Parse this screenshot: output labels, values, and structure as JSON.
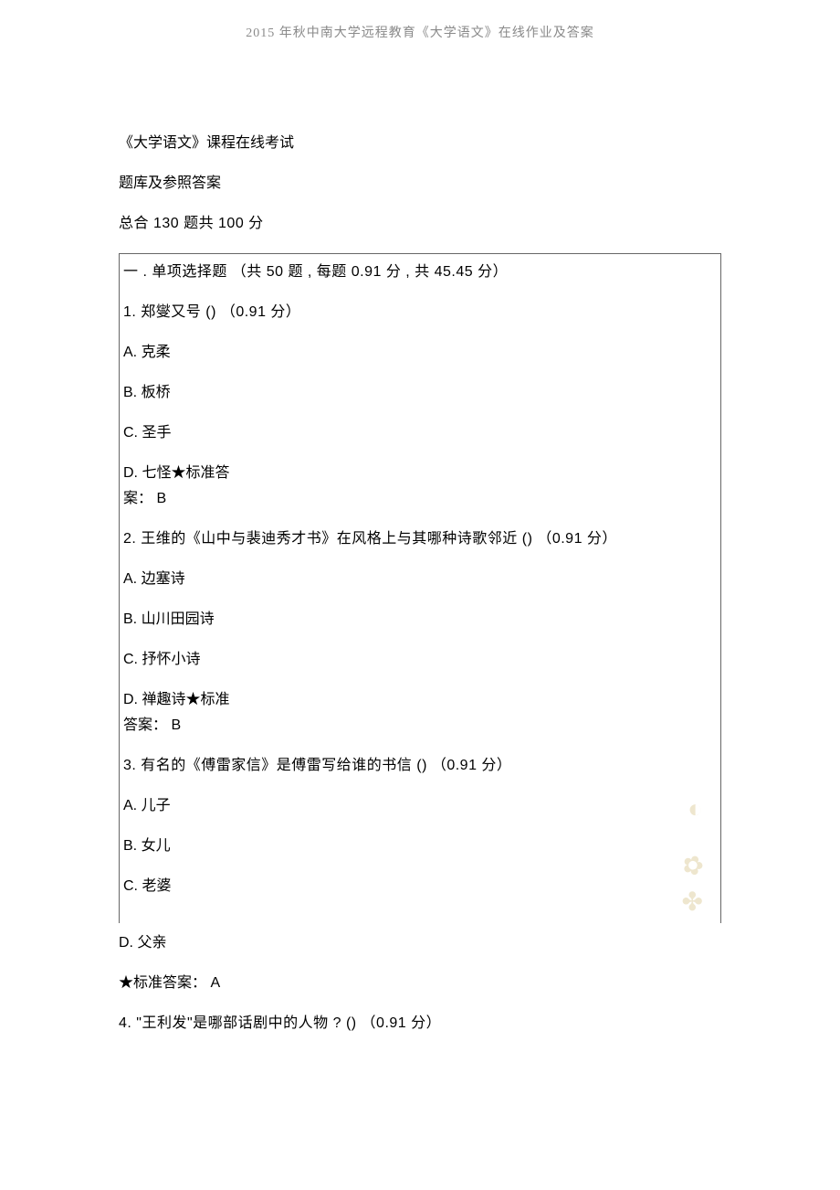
{
  "header_text": "2015 年秋中南大学远程教育《大学语文》在线作业及答案",
  "title_line": "《大学语文》课程在线考试",
  "subtitle_line": "题库及参照答案",
  "total_line": "总合 130 题共 100 分",
  "section_header": "一 . 单项选择题    （共 50 题 , 每题 0.91 分 , 共 45.45 分）",
  "q1": {
    "text": "1.  郑燮又号 ()  （0.91 分）",
    "a": "A. 克柔",
    "b": "B. 板桥",
    "c": "C. 圣手",
    "d_ans1": "D. 七怪★标准答",
    "d_ans2": "案：  B"
  },
  "q2": {
    "text": "2.  王维的《山中与裴迪秀才书》在风格上与其哪种诗歌邻近          ()  （0.91 分）",
    "a": "A. 边塞诗",
    "b": "B. 山川田园诗",
    "c": "C. 抒怀小诗",
    "d_ans1": "D. 禅趣诗★标准",
    "d_ans2": "答案：  B"
  },
  "q3": {
    "text": "3.  有名的《傅雷家信》是傅雷写给谁的书信      ()  （0.91 分）",
    "a": "A. 儿子",
    "b": "B. 女儿",
    "c": "C. 老婆",
    "d": "D. 父亲",
    "answer": "★标准答案：  A"
  },
  "q4": {
    "text": "4.  \"王利发\"是哪部话剧中的人物 ?        ()   （0.91  分）"
  }
}
